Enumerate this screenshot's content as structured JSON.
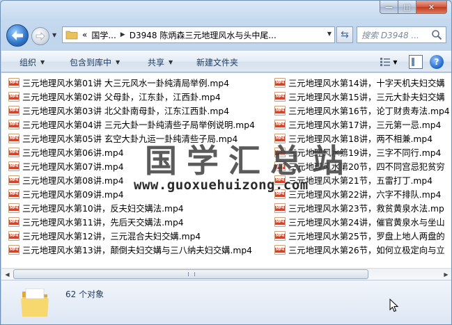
{
  "window": {
    "controls": {
      "minimize": "—",
      "maximize": "□",
      "close": "✕"
    }
  },
  "nav": {
    "address_crumbs": [
      "«",
      "国学...",
      "D3948 陈炳森三元地理风水与头中尾..."
    ],
    "search_placeholder": "搜索 D3948 ...",
    "icons": {
      "back": "back-arrow-icon",
      "forward": "forward-arrow-icon",
      "refresh": "refresh-icon",
      "search": "search-icon"
    }
  },
  "toolbar": {
    "organize": "组织",
    "include_in_library": "包含到库中",
    "share": "共享",
    "new_folder": "新建文件夹"
  },
  "files": {
    "left": [
      "三元地理风水第01讲 大三元风水一卦纯清局举例.mp4",
      "三元地理风水第02讲 父母卦，江东卦，江西卦.mp4",
      "三元地理风水第03讲 北父卦南母卦，江东江西卦.mp4",
      "三元地理风水第04讲 三元大卦一卦纯清些子局举例说明.mp4",
      "三元地理风水第05讲 玄空大卦九运一卦纯清些子局.mp4",
      "三元地理风水第06讲.mp4",
      "三元地理风水第07讲.mp4",
      "三元地理风水第08讲.mp4",
      "三元地理风水第09讲.mp4",
      "三元地理风水第10讲，反夫妇交媾法.mp4",
      "三元地理风水第11讲，先后天交媾法.mp4",
      "三元地理风水第12讲，三元混合夫妇交媾.mp4",
      "三元地理风水第13讲，颠倒夫妇交媾与三八纳夫妇交媾.mp4"
    ],
    "right": [
      "三元地理风水第14讲，十字天机夫妇交媾",
      "三元地理风水第15讲，三元大卦夫妇交媾",
      "三元地理风水第16节，论丁财贵寿法.mp4",
      "三元地理风水第17讲，三元第一忌.mp4",
      "三元地理风水第18讲，两不相兼.mp4",
      "三元地理风水第19讲，三字不同行.mp4",
      "三元地理风水第20节，四不同宫忌犯贫穷",
      "三元地理风水第21节，五雷打丁.mp4",
      "三元地理风水第22讲，六字不排队.mp4",
      "三元地理风水第23节，救贫黄泉水法.mp",
      "三元地理风水第24讲，催官黄泉水与坐山",
      "三元地理风水第25节，罗盘上地人两盘的",
      "三元地理风水第26节，如何立极定向与立"
    ]
  },
  "watermark": {
    "title": "国学汇总站",
    "url": "www.guoxuehuizong.com"
  },
  "status": {
    "count": "62 个对象"
  }
}
